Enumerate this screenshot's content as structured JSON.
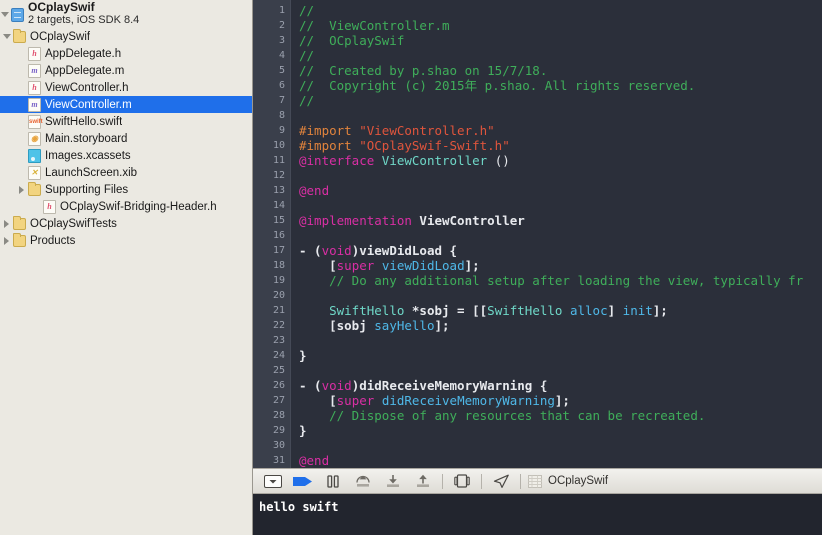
{
  "navigator": {
    "project": {
      "name": "OCplaySwif",
      "subtitle": "2 targets, iOS SDK 8.4",
      "icon": "project-blueprint-icon"
    },
    "items": [
      {
        "label": "OCplaySwif",
        "icon": "folder-icon",
        "kind": "folder",
        "indent": 1,
        "twisty": "open",
        "selected": false
      },
      {
        "label": "AppDelegate.h",
        "icon": "header-file-icon",
        "kind": "h",
        "indent": 2,
        "twisty": "none",
        "selected": false
      },
      {
        "label": "AppDelegate.m",
        "icon": "objc-file-icon",
        "kind": "m",
        "indent": 2,
        "twisty": "none",
        "selected": false
      },
      {
        "label": "ViewController.h",
        "icon": "header-file-icon",
        "kind": "h",
        "indent": 2,
        "twisty": "none",
        "selected": false
      },
      {
        "label": "ViewController.m",
        "icon": "objc-file-icon",
        "kind": "m",
        "indent": 2,
        "twisty": "none",
        "selected": true
      },
      {
        "label": "SwiftHello.swift",
        "icon": "swift-file-icon",
        "kind": "swift",
        "indent": 2,
        "twisty": "none",
        "selected": false
      },
      {
        "label": "Main.storyboard",
        "icon": "storyboard-icon",
        "kind": "story",
        "indent": 2,
        "twisty": "none",
        "selected": false
      },
      {
        "label": "Images.xcassets",
        "icon": "xcassets-icon",
        "kind": "assets",
        "indent": 2,
        "twisty": "none",
        "selected": false
      },
      {
        "label": "LaunchScreen.xib",
        "icon": "xib-file-icon",
        "kind": "xib",
        "indent": 2,
        "twisty": "none",
        "selected": false
      },
      {
        "label": "Supporting Files",
        "icon": "folder-icon",
        "kind": "folder",
        "indent": 2,
        "twisty": "closed",
        "selected": false
      },
      {
        "label": "OCplaySwif-Bridging-Header.h",
        "icon": "header-file-icon",
        "kind": "h",
        "indent": 3,
        "twisty": "none",
        "selected": false
      },
      {
        "label": "OCplaySwifTests",
        "icon": "folder-icon",
        "kind": "folder",
        "indent": 1,
        "twisty": "closed",
        "selected": false
      },
      {
        "label": "Products",
        "icon": "folder-icon",
        "kind": "folder",
        "indent": 1,
        "twisty": "closed",
        "selected": false
      }
    ]
  },
  "editor": {
    "line_numbers": [
      1,
      2,
      3,
      4,
      5,
      6,
      7,
      8,
      9,
      10,
      11,
      12,
      13,
      14,
      15,
      16,
      17,
      18,
      19,
      20,
      21,
      22,
      23,
      24,
      25,
      26,
      27,
      28,
      29,
      30,
      31
    ],
    "lines": [
      {
        "n": 1,
        "tokens": [
          {
            "t": "//",
            "c": "c-com"
          }
        ]
      },
      {
        "n": 2,
        "tokens": [
          {
            "t": "//  ViewController.m",
            "c": "c-com"
          }
        ]
      },
      {
        "n": 3,
        "tokens": [
          {
            "t": "//  OCplaySwif",
            "c": "c-com"
          }
        ]
      },
      {
        "n": 4,
        "tokens": [
          {
            "t": "//",
            "c": "c-com"
          }
        ]
      },
      {
        "n": 5,
        "tokens": [
          {
            "t": "//  Created by p.shao on 15/7/18.",
            "c": "c-com"
          }
        ]
      },
      {
        "n": 6,
        "tokens": [
          {
            "t": "//  Copyright (c) 2015年 p.shao. All rights reserved.",
            "c": "c-com"
          }
        ]
      },
      {
        "n": 7,
        "tokens": [
          {
            "t": "//",
            "c": "c-com"
          }
        ]
      },
      {
        "n": 8,
        "tokens": [
          {
            "t": "",
            "c": "c-plain"
          }
        ]
      },
      {
        "n": 9,
        "tokens": [
          {
            "t": "#import ",
            "c": "c-pre"
          },
          {
            "t": "\"ViewController.h\"",
            "c": "c-str"
          }
        ]
      },
      {
        "n": 10,
        "tokens": [
          {
            "t": "#import ",
            "c": "c-pre"
          },
          {
            "t": "\"OCplaySwif-Swift.h\"",
            "c": "c-str"
          }
        ]
      },
      {
        "n": 11,
        "tokens": [
          {
            "t": "@interface ",
            "c": "c-key"
          },
          {
            "t": "ViewController ",
            "c": "c-type"
          },
          {
            "t": "()",
            "c": "c-punct"
          }
        ]
      },
      {
        "n": 12,
        "tokens": [
          {
            "t": "",
            "c": "c-plain"
          }
        ]
      },
      {
        "n": 13,
        "tokens": [
          {
            "t": "@end",
            "c": "c-key"
          }
        ]
      },
      {
        "n": 14,
        "tokens": [
          {
            "t": "",
            "c": "c-plain"
          }
        ]
      },
      {
        "n": 15,
        "tokens": [
          {
            "t": "@implementation ",
            "c": "c-key"
          },
          {
            "t": "ViewController",
            "c": "c-plain"
          }
        ]
      },
      {
        "n": 16,
        "tokens": [
          {
            "t": "",
            "c": "c-plain"
          }
        ]
      },
      {
        "n": 17,
        "tokens": [
          {
            "t": "- (",
            "c": "c-plain"
          },
          {
            "t": "void",
            "c": "c-key"
          },
          {
            "t": ")viewDidLoad {",
            "c": "c-plain"
          }
        ]
      },
      {
        "n": 18,
        "tokens": [
          {
            "t": "    [",
            "c": "c-plain"
          },
          {
            "t": "super",
            "c": "c-key"
          },
          {
            "t": " ",
            "c": "c-plain"
          },
          {
            "t": "viewDidLoad",
            "c": "c-fn"
          },
          {
            "t": "];",
            "c": "c-plain"
          }
        ]
      },
      {
        "n": 19,
        "tokens": [
          {
            "t": "    // Do any additional setup after loading the view, typically fr",
            "c": "c-com"
          }
        ]
      },
      {
        "n": 20,
        "tokens": [
          {
            "t": "",
            "c": "c-plain"
          }
        ]
      },
      {
        "n": 21,
        "tokens": [
          {
            "t": "    ",
            "c": "c-plain"
          },
          {
            "t": "SwiftHello",
            "c": "c-type"
          },
          {
            "t": " *sobj = [[",
            "c": "c-plain"
          },
          {
            "t": "SwiftHello",
            "c": "c-type"
          },
          {
            "t": " ",
            "c": "c-plain"
          },
          {
            "t": "alloc",
            "c": "c-fn"
          },
          {
            "t": "] ",
            "c": "c-plain"
          },
          {
            "t": "init",
            "c": "c-fn"
          },
          {
            "t": "];",
            "c": "c-plain"
          }
        ]
      },
      {
        "n": 22,
        "tokens": [
          {
            "t": "    [sobj ",
            "c": "c-plain"
          },
          {
            "t": "sayHello",
            "c": "c-fn"
          },
          {
            "t": "];",
            "c": "c-plain"
          }
        ]
      },
      {
        "n": 23,
        "tokens": [
          {
            "t": "",
            "c": "c-plain"
          }
        ]
      },
      {
        "n": 24,
        "tokens": [
          {
            "t": "}",
            "c": "c-plain"
          }
        ]
      },
      {
        "n": 25,
        "tokens": [
          {
            "t": "",
            "c": "c-plain"
          }
        ]
      },
      {
        "n": 26,
        "tokens": [
          {
            "t": "- (",
            "c": "c-plain"
          },
          {
            "t": "void",
            "c": "c-key"
          },
          {
            "t": ")didReceiveMemoryWarning {",
            "c": "c-plain"
          }
        ]
      },
      {
        "n": 27,
        "tokens": [
          {
            "t": "    [",
            "c": "c-plain"
          },
          {
            "t": "super",
            "c": "c-key"
          },
          {
            "t": " ",
            "c": "c-plain"
          },
          {
            "t": "didReceiveMemoryWarning",
            "c": "c-fn"
          },
          {
            "t": "];",
            "c": "c-plain"
          }
        ]
      },
      {
        "n": 28,
        "tokens": [
          {
            "t": "    // Dispose of any resources that can be recreated.",
            "c": "c-com"
          }
        ]
      },
      {
        "n": 29,
        "tokens": [
          {
            "t": "}",
            "c": "c-plain"
          }
        ]
      },
      {
        "n": 30,
        "tokens": [
          {
            "t": "",
            "c": "c-plain"
          }
        ]
      },
      {
        "n": 31,
        "tokens": [
          {
            "t": "@end",
            "c": "c-key"
          }
        ]
      }
    ]
  },
  "debug_bar": {
    "buttons": [
      {
        "name": "toggle-debug-area-icon",
        "title": "Hide Debug Area"
      },
      {
        "name": "continue-icon",
        "title": "Continue"
      },
      {
        "name": "pause-icon",
        "title": "Pause"
      },
      {
        "name": "step-over-icon",
        "title": "Step Over"
      },
      {
        "name": "step-into-icon",
        "title": "Step Into"
      },
      {
        "name": "step-out-icon",
        "title": "Step Out"
      },
      {
        "name": "view-hierarchy-icon",
        "title": "Debug View Hierarchy"
      },
      {
        "name": "location-icon",
        "title": "Simulate Location"
      },
      {
        "name": "stack-frame-icon",
        "title": "Stack Frame"
      }
    ],
    "scheme": "OCplaySwif",
    "accent_color": "#1f6fea"
  },
  "console": {
    "output": "hello swift"
  },
  "colors": {
    "selection_blue": "#1f6fea",
    "editor_background": "#2b2f3a",
    "gutter_background": "#3a3f4b",
    "console_background": "#22252e",
    "sidebar_background": "#ebe9e2",
    "comment_green": "#3fae5a",
    "string_red": "#e0553c",
    "keyword_magenta": "#d92fa4",
    "type_cyan": "#6fd8c8",
    "method_blue": "#4fb8e8",
    "preprocessor_orange": "#e0833c"
  }
}
